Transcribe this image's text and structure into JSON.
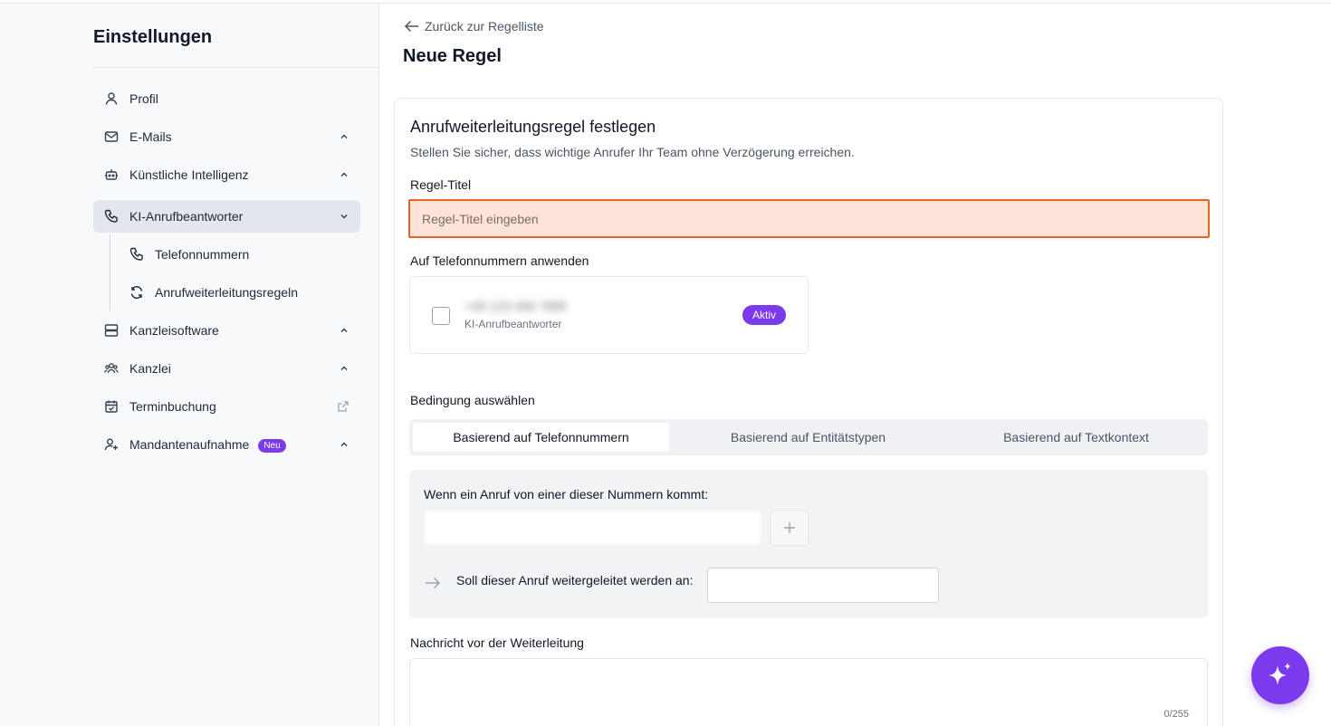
{
  "sidebar": {
    "title": "Einstellungen",
    "items": [
      {
        "label": "Profil",
        "icon": "user-icon"
      },
      {
        "label": "E-Mails",
        "icon": "mail-icon"
      },
      {
        "label": "Künstliche Intelligenz",
        "icon": "robot-icon"
      },
      {
        "label": "KI-Anrufbeantworter",
        "icon": "phone-icon"
      },
      {
        "label": "Kanzleisoftware",
        "icon": "server-icon"
      },
      {
        "label": "Kanzlei",
        "icon": "users-icon"
      },
      {
        "label": "Terminbuchung",
        "icon": "calendar-check-icon"
      },
      {
        "label": "Mandantenaufnahme",
        "icon": "user-plus-icon",
        "badge": "Neu"
      }
    ],
    "subitems": [
      {
        "label": "Telefonnummern",
        "icon": "phone-icon"
      },
      {
        "label": "Anrufweiterleitungsregeln",
        "icon": "refresh-icon"
      }
    ]
  },
  "main": {
    "back_label": "Zurück zur Regelliste",
    "page_title": "Neue Regel",
    "card": {
      "title": "Anrufweiterleitungsregel festlegen",
      "subtitle": "Stellen Sie sicher, dass wichtige Anrufer Ihr Team ohne Verzögerung erreichen.",
      "rule_title_label": "Regel-Titel",
      "rule_title_placeholder": "Regel-Titel eingeben",
      "rule_title_value": "",
      "apply_label": "Auf Telefonnummern anwenden",
      "phone": {
        "number": "+49 123 456 7890",
        "type": "KI-Anrufbeantworter",
        "status": "Aktiv",
        "checked": false
      },
      "condition_label": "Bedingung auswählen",
      "tabs": [
        "Basierend auf Telefonnummern",
        "Basierend auf Entitätstypen",
        "Basierend auf Textkontext"
      ],
      "active_tab": 0,
      "condition_text": "Wenn ein Anruf von einer dieser Nummern kommt:",
      "forward_text": "Soll dieser Anruf weitergeleitet werden an:",
      "message_label": "Nachricht vor der Weiterleitung",
      "message_counter": "0/255"
    }
  },
  "colors": {
    "accent": "#7c3aed",
    "error_border": "#e4661f",
    "error_bg": "#fde4d9"
  }
}
